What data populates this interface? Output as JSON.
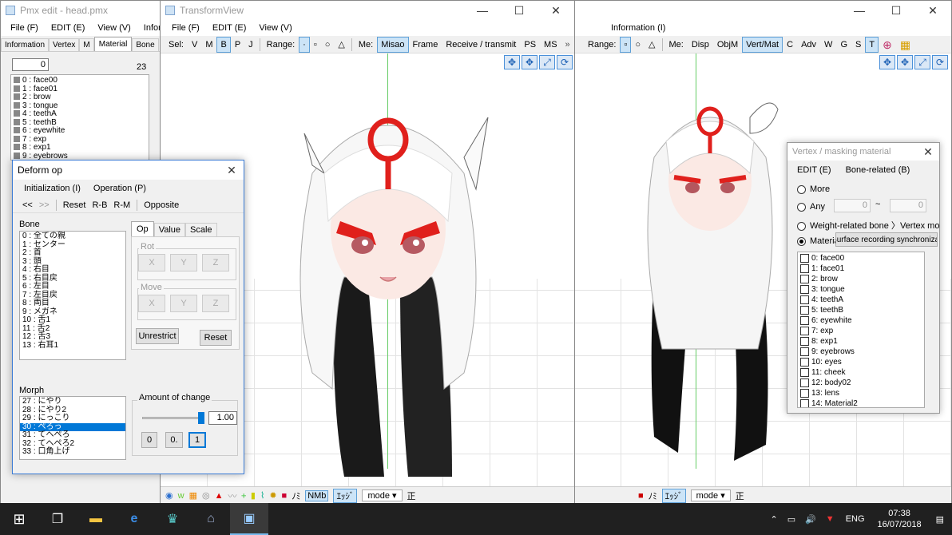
{
  "pmx_window": {
    "title": "Pmx edit - head.pmx",
    "menu": [
      "File (F)",
      "EDIT (E)",
      "View (V)",
      "Inform"
    ],
    "tabs": [
      "Information",
      "Vertex",
      "M",
      "Material",
      "Bone"
    ],
    "search_value": "0",
    "count": "23",
    "materials": [
      "0 : face00",
      "1 : face01",
      "2 : brow",
      "3 : tongue",
      "4 : teethA",
      "5 : teethB",
      "6 : eyewhite",
      "7 : exp",
      "8 : exp1",
      "9 : eyebrows"
    ]
  },
  "transform_view": {
    "title": "TransformView",
    "menu": [
      "File (F)",
      "EDIT (E)",
      "View (V)"
    ],
    "toolbar": [
      "Sel:",
      "V",
      "M",
      "B",
      "P",
      "J",
      "Range:",
      "·",
      "▫",
      "○",
      "△",
      "Me:",
      "Misao",
      "Frame",
      "Receive / transmit",
      "PS",
      "MS"
    ],
    "status": [
      "mode",
      "正",
      "ﾉﾐ",
      "ｴｯｼﾞ"
    ]
  },
  "right_view": {
    "menu": [
      "Information (I)"
    ],
    "toolbar": [
      "Range:",
      "▫",
      "○",
      "△",
      "Me:",
      "Disp",
      "ObjM",
      "Vert/Mat",
      "C",
      "Adv",
      "W",
      "G",
      "S",
      "T"
    ],
    "status": [
      "mode",
      "正",
      "ﾉﾐ",
      "ｴｯｼﾞ"
    ]
  },
  "deform": {
    "title": "Deform op",
    "menu": [
      "Initialization (I)",
      "Operation (P)"
    ],
    "toolbar": [
      "<<",
      ">>",
      "Reset",
      "R-B",
      "R-M",
      "Opposite"
    ],
    "bone_label": "Bone",
    "bones": [
      "0 : 全ての親",
      "1 : センター",
      "2 : 首",
      "3 : 頭",
      "4 : 右目",
      "5 : 右目戻",
      "6 : 左目",
      "7 : 左目戻",
      "8 : 両目",
      "9 : メガネ",
      "10 : 舌1",
      "11 : 舌2",
      "12 : 舌3",
      "13 : 右耳1"
    ],
    "tabs": [
      "Op",
      "Value",
      "Scale"
    ],
    "rot_label": "Rot",
    "move_label": "Move",
    "axes": [
      "X",
      "Y",
      "Z"
    ],
    "unrestrict": "Unrestrict",
    "reset": "Reset",
    "morph_label": "Morph",
    "morphs": [
      "27 : にやり",
      "28 : にやり2",
      "29 : にっこり",
      "30 : ぺろっ",
      "31 : てへぺろ",
      "32 : てへぺろ2",
      "33 : 口角上げ"
    ],
    "morph_selected": 3,
    "amount_label": "Amount of change",
    "amount_value": "1.00",
    "amount_fraction": 1.0,
    "preset_buttons": [
      "0",
      "0.",
      "1"
    ]
  },
  "masking": {
    "title": "Vertex / masking material",
    "menu": [
      "EDIT (E)",
      "Bone-related (B)"
    ],
    "opt_more": "More",
    "opt_any": "Any",
    "any_from": "0",
    "any_tilde": "~",
    "any_to": "0",
    "opt_weight": "Weight-related bone",
    "vertex_morph": "Vertex morph",
    "opt_material": "Materia",
    "surface_btn": "Surface recording synchronizat",
    "materials": [
      "0: face00",
      "1: face01",
      "2: brow",
      "3: tongue",
      "4: teethA",
      "5: teethB",
      "6: eyewhite",
      "7: exp",
      "8: exp1",
      "9: eyebrows",
      "10: eyes",
      "11: cheek",
      "12: body02",
      "13: lens",
      "14: Material2"
    ]
  },
  "taskbar": {
    "lang": "ENG",
    "time": "07:38",
    "date": "16/07/2018"
  },
  "colors": {
    "accent": "#0078d7",
    "taskbar": "#202020",
    "face_paint": "#e0201c"
  }
}
